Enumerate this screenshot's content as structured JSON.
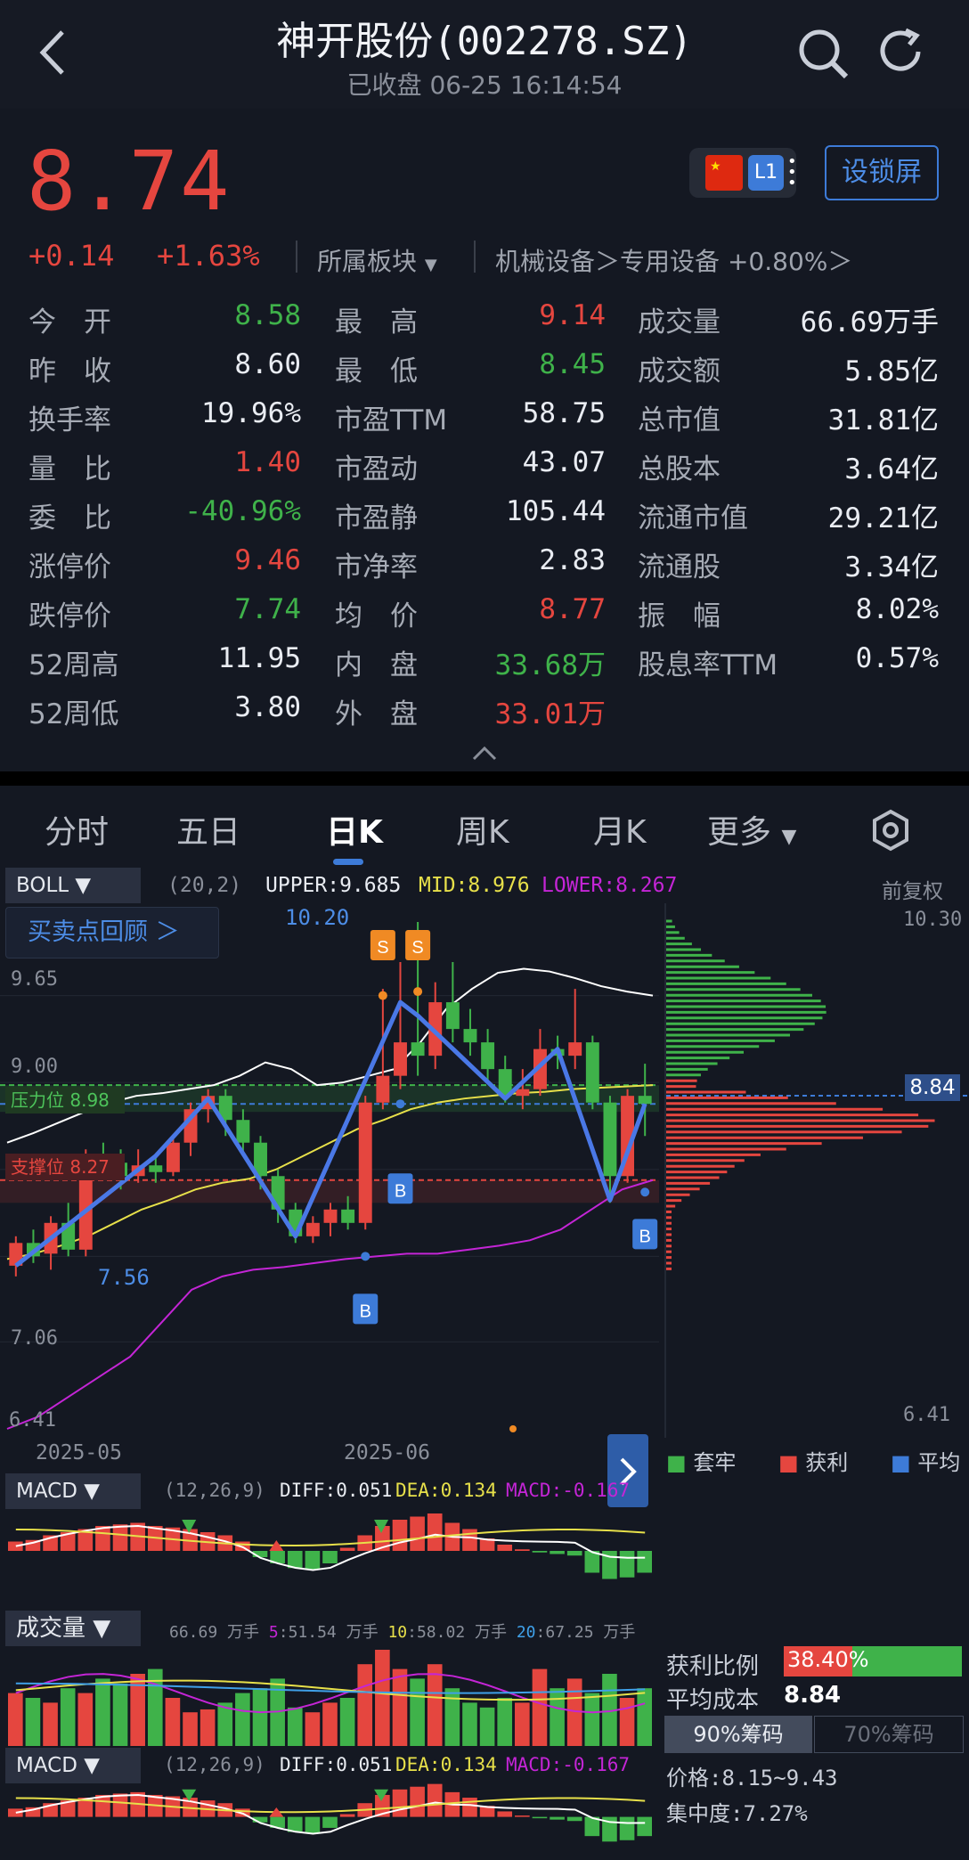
{
  "header": {
    "title": "神开股份(002278.SZ)",
    "status": "已收盘",
    "datetime": "06-25  16:14:54",
    "lock_label": "设锁屏",
    "level_badge": "L1"
  },
  "quote": {
    "price": "8.74",
    "change": "+0.14",
    "change_pct": "+1.63%",
    "sector_label": "所属板块",
    "industry": "机械设备",
    "sub_industry": "专用设备",
    "sub_industry_pct": "+0.80%"
  },
  "stats": [
    {
      "l1": "今　开",
      "v1": "8.58",
      "c1": "green",
      "l2": "最　高",
      "v2": "9.14",
      "c2": "red",
      "l3": "成交量",
      "v3": "66.69万手",
      "c3": "white"
    },
    {
      "l1": "昨　收",
      "v1": "8.60",
      "c1": "white",
      "l2": "最　低",
      "v2": "8.45",
      "c2": "green",
      "l3": "成交额",
      "v3": "5.85亿",
      "c3": "white"
    },
    {
      "l1": "换手率",
      "v1": "19.96%",
      "c1": "white",
      "l2": "市盈TTM",
      "v2": "58.75",
      "c2": "white",
      "l3": "总市值",
      "v3": "31.81亿",
      "c3": "white"
    },
    {
      "l1": "量　比",
      "v1": "1.40",
      "c1": "red",
      "l2": "市盈动",
      "v2": "43.07",
      "c2": "white",
      "l3": "总股本",
      "v3": "3.64亿",
      "c3": "white"
    },
    {
      "l1": "委　比",
      "v1": "-40.96%",
      "c1": "green",
      "l2": "市盈静",
      "v2": "105.44",
      "c2": "white",
      "l3": "流通市值",
      "v3": "29.21亿",
      "c3": "white"
    },
    {
      "l1": "涨停价",
      "v1": "9.46",
      "c1": "red",
      "l2": "市净率",
      "v2": "2.83",
      "c2": "white",
      "l3": "流通股",
      "v3": "3.34亿",
      "c3": "white"
    },
    {
      "l1": "跌停价",
      "v1": "7.74",
      "c1": "green",
      "l2": "均　价",
      "v2": "8.77",
      "c2": "red",
      "l3": "振　幅",
      "v3": "8.02%",
      "c3": "white"
    },
    {
      "l1": "52周高",
      "v1": "11.95",
      "c1": "white",
      "l2": "内　盘",
      "v2": "33.68万",
      "c2": "green",
      "l3": "股息率TTM",
      "v3": "0.57%",
      "c3": "white"
    },
    {
      "l1": "52周低",
      "v1": "3.80",
      "c1": "white",
      "l2": "外　盘",
      "v2": "33.01万",
      "c2": "red",
      "l3": "",
      "v3": "",
      "c3": "white"
    }
  ],
  "tabs": [
    "分时",
    "五日",
    "日K",
    "周K",
    "月K",
    "更多"
  ],
  "active_tab": "日K",
  "boll": {
    "name": "BOLL",
    "params": "(20,2)",
    "upper": "UPPER:9.685",
    "mid": "MID:8.976",
    "lower": "LOWER:8.267",
    "adjust": "前复权"
  },
  "review_btn": "买卖点回顾 ＞",
  "levels": {
    "resistance": "压力位 8.98",
    "support": "支撑位 8.27",
    "current": "8.84"
  },
  "price_axis": {
    "top_left": "9.65",
    "l2": "9.00",
    "l3": "8.35",
    "l4": "7.70",
    "l5": "7.06",
    "bottom": "6.41",
    "right_top": "10.30",
    "right_bottom": "6.41",
    "max_label": "10.20",
    "min_label": "7.56"
  },
  "dates": [
    "2025-05",
    "2025-06"
  ],
  "chip_legend": [
    "套牢",
    "获利",
    "平均"
  ],
  "macd": {
    "name": "MACD",
    "params": "(12,26,9)",
    "diff": "DIFF:0.051",
    "dea": "DEA:0.134",
    "macd": "MACD:-0.167"
  },
  "volume": {
    "name": "成交量",
    "v": "66.69",
    "unit": "万手",
    "ma5": "51.54",
    "ma10": "58.02",
    "ma20": "67.25",
    "k5": "5",
    "k10": "10",
    "k20": "20"
  },
  "chips": {
    "profit_label": "获利比例",
    "profit": "38.40%",
    "profit_ratio": 0.384,
    "avg_label": "平均成本",
    "avg": "8.84",
    "tab90": "90%筹码",
    "tab70": "70%筹码",
    "range": "价格:8.15~9.43",
    "concentration": "集中度:7.27%"
  },
  "colors": {
    "up": "#e5463f",
    "down": "#3fb24a",
    "accent": "#3d7bd8",
    "boll_upper": "#ffffff",
    "boll_mid": "#e7e04a",
    "boll_lower": "#c425d6"
  },
  "chart_data": {
    "type": "candlestick",
    "ylim": [
      6.41,
      10.3
    ],
    "candles": [
      [
        7.63,
        7.8,
        7.55,
        7.85
      ],
      [
        7.8,
        7.7,
        7.65,
        7.9
      ],
      [
        7.72,
        7.95,
        7.6,
        8.0
      ],
      [
        7.95,
        7.75,
        7.7,
        8.1
      ],
      [
        7.75,
        8.45,
        7.7,
        8.5
      ],
      [
        8.45,
        8.4,
        8.3,
        8.55
      ],
      [
        8.4,
        8.3,
        8.2,
        8.5
      ],
      [
        8.3,
        8.38,
        8.25,
        8.5
      ],
      [
        8.38,
        8.33,
        8.25,
        8.45
      ],
      [
        8.33,
        8.55,
        8.3,
        8.6
      ],
      [
        8.55,
        8.8,
        8.45,
        8.85
      ],
      [
        8.8,
        8.9,
        8.7,
        8.95
      ],
      [
        8.9,
        8.72,
        8.6,
        8.95
      ],
      [
        8.72,
        8.55,
        8.45,
        8.8
      ],
      [
        8.55,
        8.3,
        8.2,
        8.6
      ],
      [
        8.3,
        8.05,
        7.95,
        8.35
      ],
      [
        8.05,
        7.85,
        7.8,
        8.1
      ],
      [
        7.85,
        7.95,
        7.8,
        8.0
      ],
      [
        7.95,
        8.05,
        7.85,
        8.1
      ],
      [
        8.05,
        7.95,
        7.9,
        8.15
      ],
      [
        7.95,
        8.85,
        7.9,
        8.9
      ],
      [
        8.85,
        9.05,
        8.8,
        9.7
      ],
      [
        9.05,
        9.3,
        8.95,
        9.9
      ],
      [
        9.3,
        9.2,
        9.05,
        10.2
      ],
      [
        9.2,
        9.6,
        9.1,
        9.75
      ],
      [
        9.6,
        9.4,
        9.3,
        9.9
      ],
      [
        9.4,
        9.3,
        9.2,
        9.55
      ],
      [
        9.3,
        9.1,
        9.0,
        9.4
      ],
      [
        9.1,
        8.9,
        8.85,
        9.2
      ],
      [
        8.9,
        8.95,
        8.8,
        9.1
      ],
      [
        8.95,
        9.25,
        8.9,
        9.4
      ],
      [
        9.25,
        9.2,
        9.1,
        9.35
      ],
      [
        9.2,
        9.3,
        9.1,
        9.7
      ],
      [
        9.3,
        8.85,
        8.8,
        9.35
      ],
      [
        8.85,
        8.3,
        8.1,
        8.9
      ],
      [
        8.3,
        8.9,
        8.25,
        8.95
      ],
      [
        8.9,
        8.84,
        8.6,
        9.14
      ]
    ],
    "boll_upper": [
      8.55,
      8.62,
      8.7,
      8.78,
      8.85,
      8.9,
      8.92,
      8.95,
      8.98,
      9.05,
      9.15,
      9.1,
      8.98,
      9.0,
      9.05,
      9.1,
      9.3,
      9.55,
      9.7,
      9.82,
      9.85,
      9.83,
      9.78,
      9.72,
      9.68,
      9.65
    ],
    "boll_mid": [
      7.68,
      7.72,
      7.78,
      7.85,
      7.95,
      8.05,
      8.12,
      8.2,
      8.25,
      8.28,
      8.35,
      8.45,
      8.55,
      8.65,
      8.72,
      8.8,
      8.85,
      8.88,
      8.9,
      8.92,
      8.93,
      8.95,
      8.96,
      8.97,
      8.98
    ],
    "boll_lower": [
      6.41,
      6.5,
      6.65,
      6.8,
      6.95,
      7.2,
      7.45,
      7.55,
      7.6,
      7.62,
      7.65,
      7.68,
      7.7,
      7.72,
      7.72,
      7.75,
      7.78,
      7.82,
      7.9,
      8.05,
      8.2,
      8.27
    ]
  }
}
